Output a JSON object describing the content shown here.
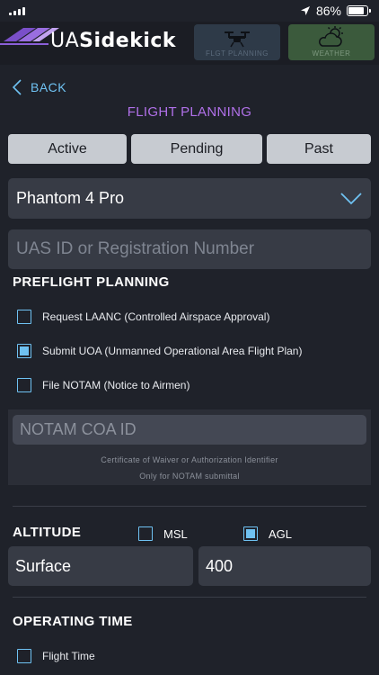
{
  "status_bar": {
    "battery": "86%",
    "battery_level": 0.86
  },
  "app_bar": {
    "logo_prefix": "UA",
    "logo_suffix": "Sidekick",
    "flight_planning_label": "FLGT PLANNING",
    "weather_label": "WEATHER"
  },
  "nav": {
    "back_label": "BACK",
    "title": "FLIGHT PLANNING"
  },
  "tabs": [
    {
      "label": "Active"
    },
    {
      "label": "Pending"
    },
    {
      "label": "Past"
    }
  ],
  "aircraft_select": {
    "value": "Phantom 4 Pro"
  },
  "uas_id": {
    "placeholder": "UAS ID or Registration Number",
    "value": ""
  },
  "preflight": {
    "title": "PREFLIGHT PLANNING",
    "options": [
      {
        "label": "Request LAANC (Controlled Airspace Approval)",
        "checked": false
      },
      {
        "label": "Submit UOA (Unmanned Operational Area Flight Plan)",
        "checked": true
      },
      {
        "label": "File NOTAM (Notice to Airmen)",
        "checked": false
      }
    ]
  },
  "notam": {
    "placeholder": "NOTAM COA ID",
    "help_line1": "Certificate of Waiver or Authorization Identifier",
    "help_line2": "Only for NOTAM submittal"
  },
  "altitude": {
    "title": "ALTITUDE",
    "msl_label": "MSL",
    "msl_checked": false,
    "agl_label": "AGL",
    "agl_checked": true,
    "min_value": "Surface",
    "max_value": "400"
  },
  "operating_time": {
    "title": "OPERATING TIME",
    "flight_time_label": "Flight Time",
    "flight_time_checked": false
  },
  "colors": {
    "accent_blue": "#6fc2f2",
    "title_purple": "#b070e8",
    "background": "#1f222a"
  }
}
